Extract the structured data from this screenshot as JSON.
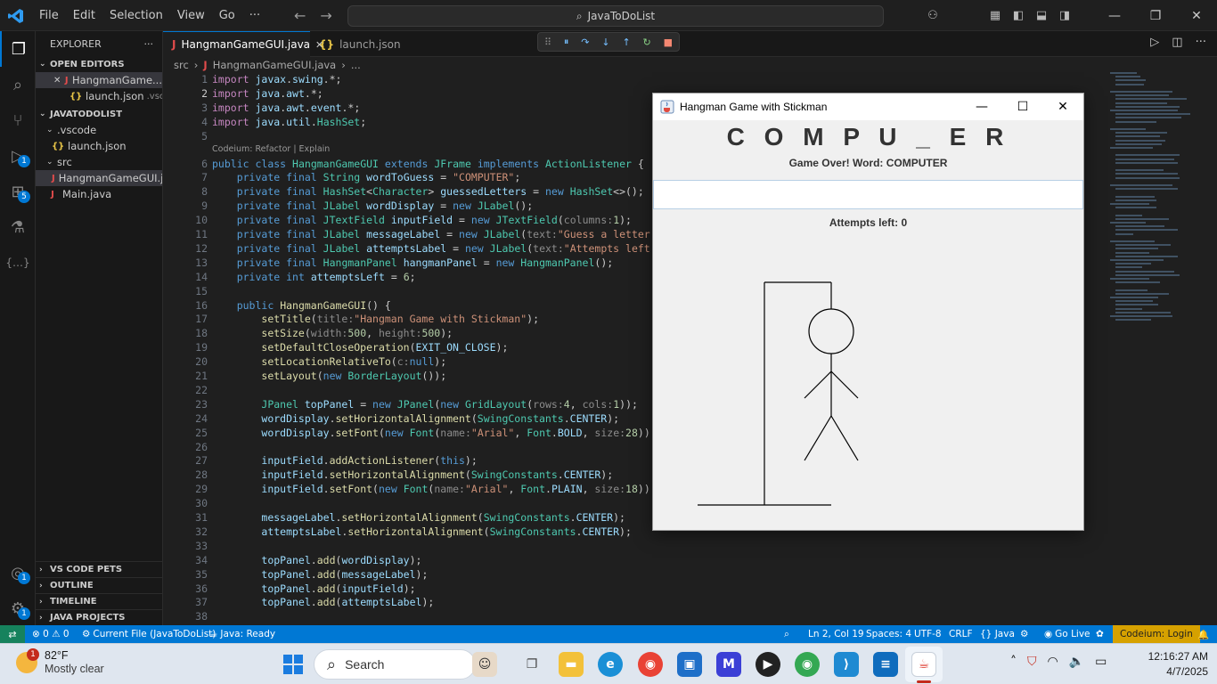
{
  "titlebar": {
    "menu": [
      "File",
      "Edit",
      "Selection",
      "View",
      "Go",
      "···"
    ],
    "search": "JavaToDoList"
  },
  "activity": {
    "badges": {
      "debug": "1",
      "extensions": "5",
      "accounts": "1",
      "manage": "1"
    }
  },
  "explorer": {
    "title": "EXPLORER",
    "more": "···",
    "open_editors_label": "OPEN EDITORS",
    "open_editors": [
      {
        "icon": "J",
        "name": "HangmanGame...",
        "extra": ""
      },
      {
        "icon": "{}",
        "name": "launch.json",
        "extra": ".vsco..."
      }
    ],
    "project_label": "JAVATODOLIST",
    "tree": [
      {
        "name": ".vscode"
      },
      {
        "icon": "{}",
        "name": "launch.json"
      },
      {
        "name": "src"
      },
      {
        "icon": "J",
        "name": "HangmanGameGUI.j..."
      },
      {
        "icon": "J",
        "name": "Main.java"
      }
    ],
    "bottom_sections": [
      "VS CODE PETS",
      "OUTLINE",
      "TIMELINE",
      "JAVA PROJECTS"
    ]
  },
  "tabs": [
    {
      "icon": "J",
      "label": "HangmanGameGUI.java",
      "close": "✕"
    },
    {
      "icon": "{}",
      "label": "launch.json"
    }
  ],
  "breadcrumb": [
    "src",
    "J",
    "HangmanGameGUI.java",
    "..."
  ],
  "codelens": "Codeium: Refactor | Explain",
  "line_numbers": [
    "1",
    "2",
    "3",
    "4",
    "5",
    "6",
    "7",
    "8",
    "9",
    "10",
    "11",
    "12",
    "13",
    "14",
    "15",
    "16",
    "17",
    "18",
    "19",
    "20",
    "21",
    "22",
    "23",
    "24",
    "25",
    "26",
    "27",
    "28",
    "29",
    "30",
    "31",
    "32",
    "33",
    "34",
    "35",
    "36",
    "37",
    "38"
  ],
  "java_window": {
    "title": "Hangman Game with Stickman",
    "word": "C O M P U _ E R",
    "message": "Game Over! Word: COMPUTER",
    "attempts": "Attempts left: 0"
  },
  "status": {
    "errors": "⊗ 0 ⚠ 0",
    "current_file": "Current File (JavaToDoList)",
    "java": "Java: Ready",
    "position": "Ln 2, Col 19",
    "spaces": "Spaces: 4",
    "encoding": "UTF-8",
    "eol": "CRLF",
    "language": "{} Java",
    "golive": "Go Live",
    "codeium": "Codeium: Login"
  },
  "taskbar": {
    "temp": "82°F",
    "weather": "Mostly clear",
    "weather_badge": "1",
    "search": "Search",
    "time": "12:16:27 AM",
    "date": "4/7/2025"
  },
  "colors": {
    "accent": "#0078d4",
    "remote": "#16825d",
    "codeium": "#d6a100"
  }
}
